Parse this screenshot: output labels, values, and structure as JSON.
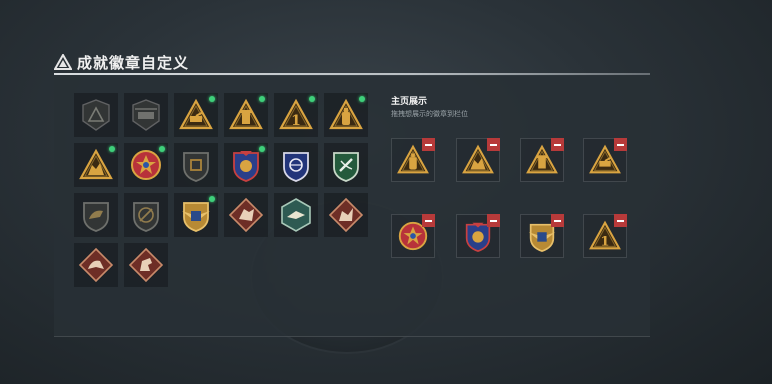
{
  "header": {
    "title": "成就徽章自定义"
  },
  "display": {
    "title": "主页展示",
    "hint": "拖拽想展示的徽章到栏位"
  },
  "badges": [
    {
      "shape": "dark-shield",
      "locked": true
    },
    {
      "shape": "dark-heli",
      "locked": true
    },
    {
      "shape": "gold-tri-tank",
      "new": true
    },
    {
      "shape": "gold-tri-tower",
      "new": true
    },
    {
      "shape": "gold-tri-one",
      "new": true
    },
    {
      "shape": "gold-tri-bottle",
      "new": true
    },
    {
      "shape": "gold-tri-bear",
      "new": true
    },
    {
      "shape": "medal-star",
      "new": true
    },
    {
      "shape": "dark-shield-hand",
      "locked": true
    },
    {
      "shape": "blue-shield-star",
      "new": true
    },
    {
      "shape": "blue-shield-globe",
      "new": false
    },
    {
      "shape": "green-shield",
      "new": false
    },
    {
      "shape": "dark-shield-wolf",
      "locked": true
    },
    {
      "shape": "dark-shield-knife",
      "locked": true
    },
    {
      "shape": "gold-shield-wings",
      "new": true
    },
    {
      "shape": "red-diamond-wolf",
      "new": false
    },
    {
      "shape": "green-hex-bird",
      "new": false
    },
    {
      "shape": "red-diamond-dragon",
      "new": false
    },
    {
      "shape": "red-diamond-beast",
      "new": false
    },
    {
      "shape": "red-diamond-horse",
      "new": false
    }
  ],
  "showcase": [
    {
      "shape": "gold-tri-bottle"
    },
    {
      "shape": "gold-tri-bear"
    },
    {
      "shape": "gold-tri-tower"
    },
    {
      "shape": "gold-tri-tank"
    },
    {
      "shape": "medal-star"
    },
    {
      "shape": "blue-shield-star"
    },
    {
      "shape": "gold-shield-wings"
    },
    {
      "shape": "gold-tri-one"
    }
  ],
  "colors": {
    "new_dot": "#3ecf7a",
    "remove": "#b73a3a",
    "gold": "#d9a441"
  }
}
